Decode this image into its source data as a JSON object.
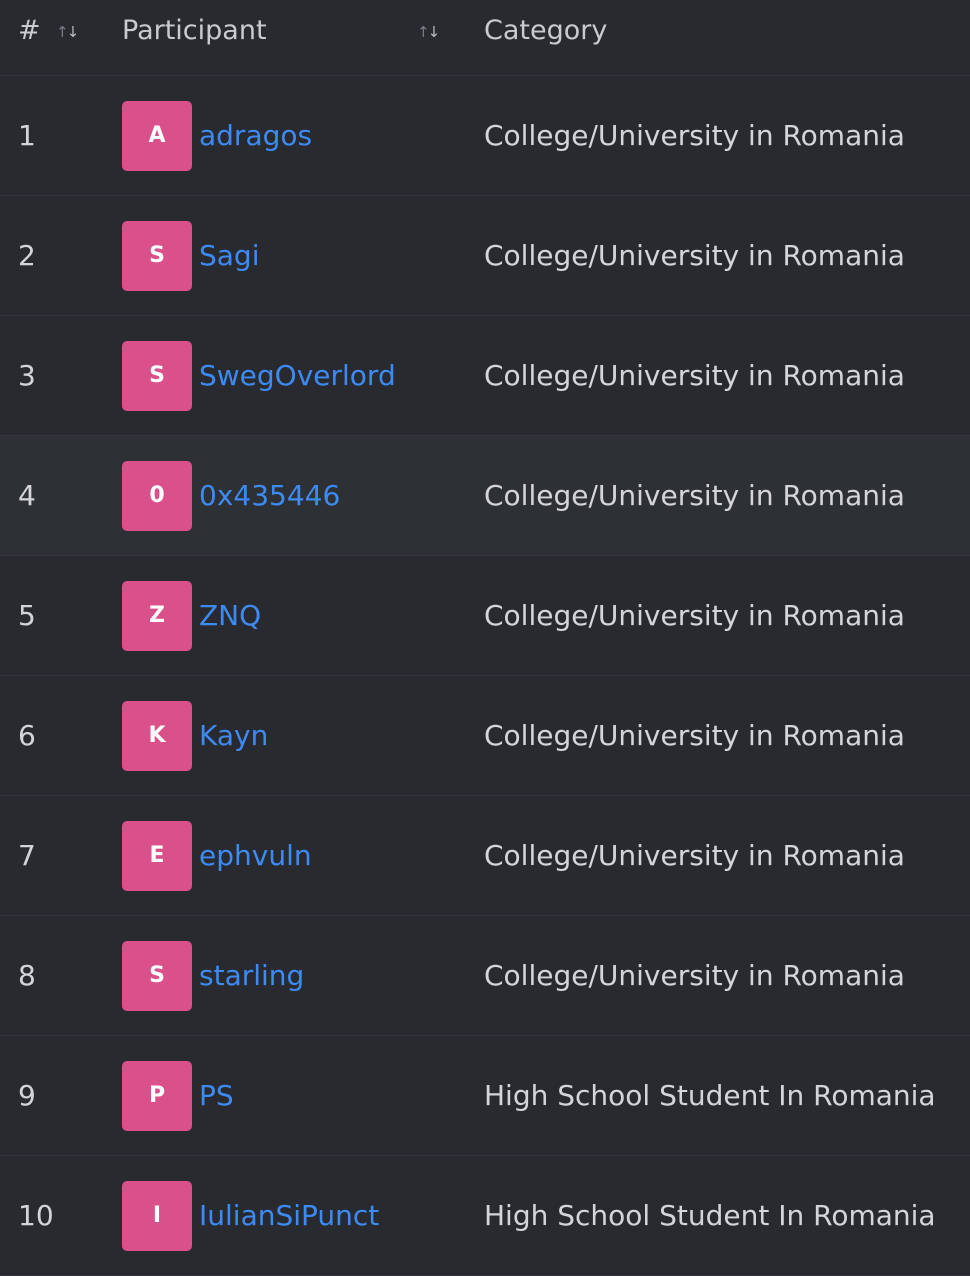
{
  "header": {
    "rank_label": "#",
    "participant_label": "Participant",
    "category_label": "Category"
  },
  "rows": [
    {
      "rank": "1",
      "initial": "A",
      "name": "adragos",
      "category": "College/University in Romania"
    },
    {
      "rank": "2",
      "initial": "S",
      "name": "Sagi",
      "category": "College/University in Romania"
    },
    {
      "rank": "3",
      "initial": "S",
      "name": "SwegOverlord",
      "category": "College/University in Romania"
    },
    {
      "rank": "4",
      "initial": "0",
      "name": "0x435446",
      "category": "College/University in Romania"
    },
    {
      "rank": "5",
      "initial": "Z",
      "name": "ZNQ",
      "category": "College/University in Romania"
    },
    {
      "rank": "6",
      "initial": "K",
      "name": "Kayn",
      "category": "College/University in Romania"
    },
    {
      "rank": "7",
      "initial": "E",
      "name": "ephvuln",
      "category": "College/University in Romania"
    },
    {
      "rank": "8",
      "initial": "S",
      "name": "starling",
      "category": "College/University in Romania"
    },
    {
      "rank": "9",
      "initial": "P",
      "name": "PS",
      "category": "High School Student In Romania"
    },
    {
      "rank": "10",
      "initial": "I",
      "name": "IulianSiPunct",
      "category": "High School Student In Romania"
    }
  ],
  "colors": {
    "background": "#282a2f",
    "avatar": "#d9508a",
    "link": "#3d8bf2",
    "text": "#d3d5da"
  },
  "icons": {
    "sort": "sort-arrows-icon"
  }
}
